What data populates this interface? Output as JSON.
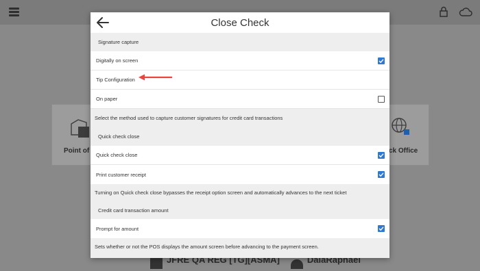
{
  "modal": {
    "title": "Close Check",
    "sections": [
      {
        "header": "Signature capture",
        "rows": [
          {
            "label": "Digitally on screen",
            "checked": true
          },
          {
            "label": "Tip Configuration",
            "checked": null,
            "annotated": true
          },
          {
            "label": "On paper",
            "checked": false
          }
        ],
        "description": "Select the method used to capture customer signatures for credit card transactions"
      },
      {
        "header": "Quick check close",
        "rows": [
          {
            "label": "Quick check close",
            "checked": true
          },
          {
            "label": "Print customer receipt",
            "checked": true
          }
        ],
        "description": "Turning on Quick check close bypasses the receipt option screen and automatically advances to the next ticket"
      },
      {
        "header": "Credit card transaction amount",
        "rows": [
          {
            "label": "Prompt for amount",
            "checked": true
          }
        ],
        "description": "Sets whether or not the POS displays the amount screen before advancing to the payment screen."
      }
    ]
  },
  "background": {
    "tile_left_label": "Point of S",
    "tile_right_label": "ck Office",
    "footer_text": "JFRE QA REG [TG][ASMA]",
    "footer_user": "DalaRaphael"
  },
  "colors": {
    "checkbox_on": "#2f79d3",
    "annotation_arrow": "#e8463c",
    "overlay": "#898989"
  },
  "icons": [
    "menu-icon",
    "lock-icon",
    "cloud-icon",
    "back-arrow-icon",
    "check-icon",
    "pos-terminal-icon",
    "globe-plug-icon"
  ]
}
